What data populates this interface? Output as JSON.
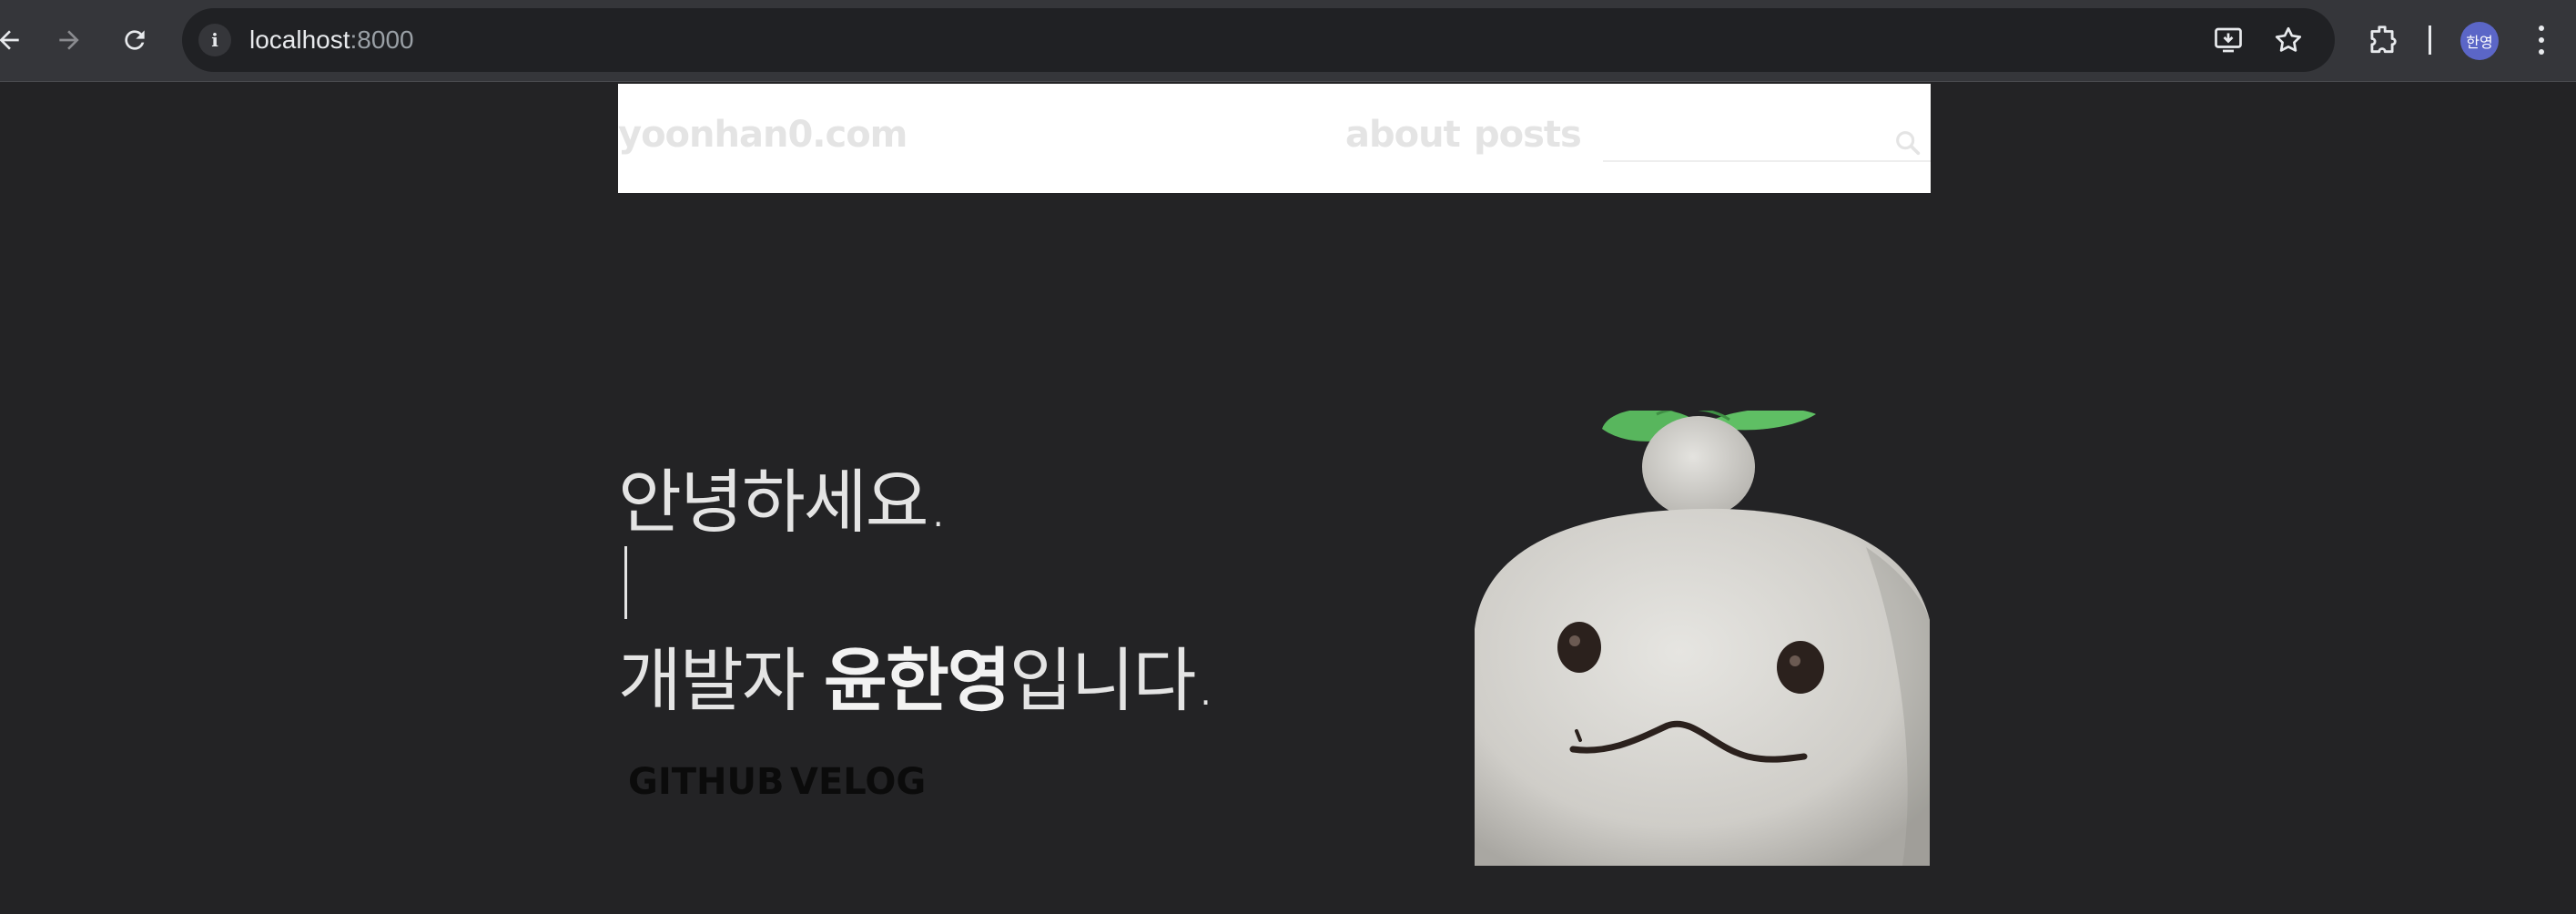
{
  "browser": {
    "url_host": "localhost",
    "url_port": ":8000",
    "avatar_text": "한영",
    "icons": [
      "back-icon",
      "forward-icon",
      "reload-icon",
      "info-icon",
      "install-icon",
      "star-icon",
      "extensions-icon",
      "more-icon"
    ]
  },
  "header": {
    "brand": "yoonhan0.com",
    "nav": [
      {
        "label": "about"
      },
      {
        "label": "posts"
      }
    ],
    "search": {
      "placeholder": "",
      "value": ""
    }
  },
  "hero": {
    "greeting": "안녕하세요.",
    "intro_prefix": "개발자 ",
    "intro_name": "윤한영",
    "intro_suffix": "입니다.",
    "links": [
      {
        "label": "GITHUB"
      },
      {
        "label": "VELOG"
      }
    ]
  },
  "profile": {
    "alt": "plush radish mascot",
    "colors": {
      "body": "#d9d8d3",
      "leaf": "#58b65d",
      "eye": "#2b211d",
      "mouth": "#2b211d",
      "bg": "#232325"
    }
  }
}
